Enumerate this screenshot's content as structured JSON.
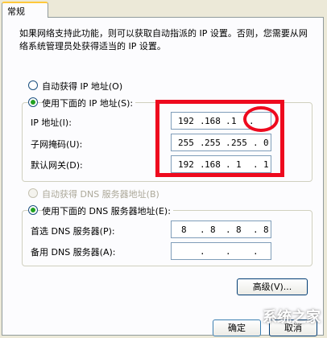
{
  "tabs": [
    {
      "label": "常规"
    }
  ],
  "description": "如果网络支持此功能，则可以获取自动指派的 IP 设置。否则，您需要从网络系统管理员处获得适当的 IP 设置。",
  "ip_section": {
    "auto_label": "自动获得 IP 地址(O)",
    "manual_label": "使用下面的 IP 地址(S):",
    "selected": "manual",
    "fields": [
      {
        "label": "IP 地址(I):",
        "octets": [
          "192",
          "168",
          "1",
          ""
        ]
      },
      {
        "label": "子网掩码(U):",
        "octets": [
          "255",
          "255",
          "255",
          "0"
        ]
      },
      {
        "label": "默认网关(D):",
        "octets": [
          "192",
          "168",
          "1",
          "1"
        ]
      }
    ]
  },
  "dns_section": {
    "auto_label": "自动获得 DNS 服务器地址(B)",
    "manual_label": "使用下面的 DNS 服务器地址(E):",
    "selected": "manual",
    "fields": [
      {
        "label": "首选 DNS 服务器(P):",
        "octets": [
          "8",
          "8",
          "8",
          "8"
        ]
      },
      {
        "label": "备用 DNS 服务器(A):",
        "octets": [
          "",
          "",
          "",
          ""
        ]
      }
    ]
  },
  "buttons": {
    "advanced": "高级(V)...",
    "ok": "确定",
    "cancel": "取消"
  },
  "watermark": "系统之家",
  "colors": {
    "annotation_red": "#ee0a1e",
    "radio_selected": "#21a121"
  }
}
